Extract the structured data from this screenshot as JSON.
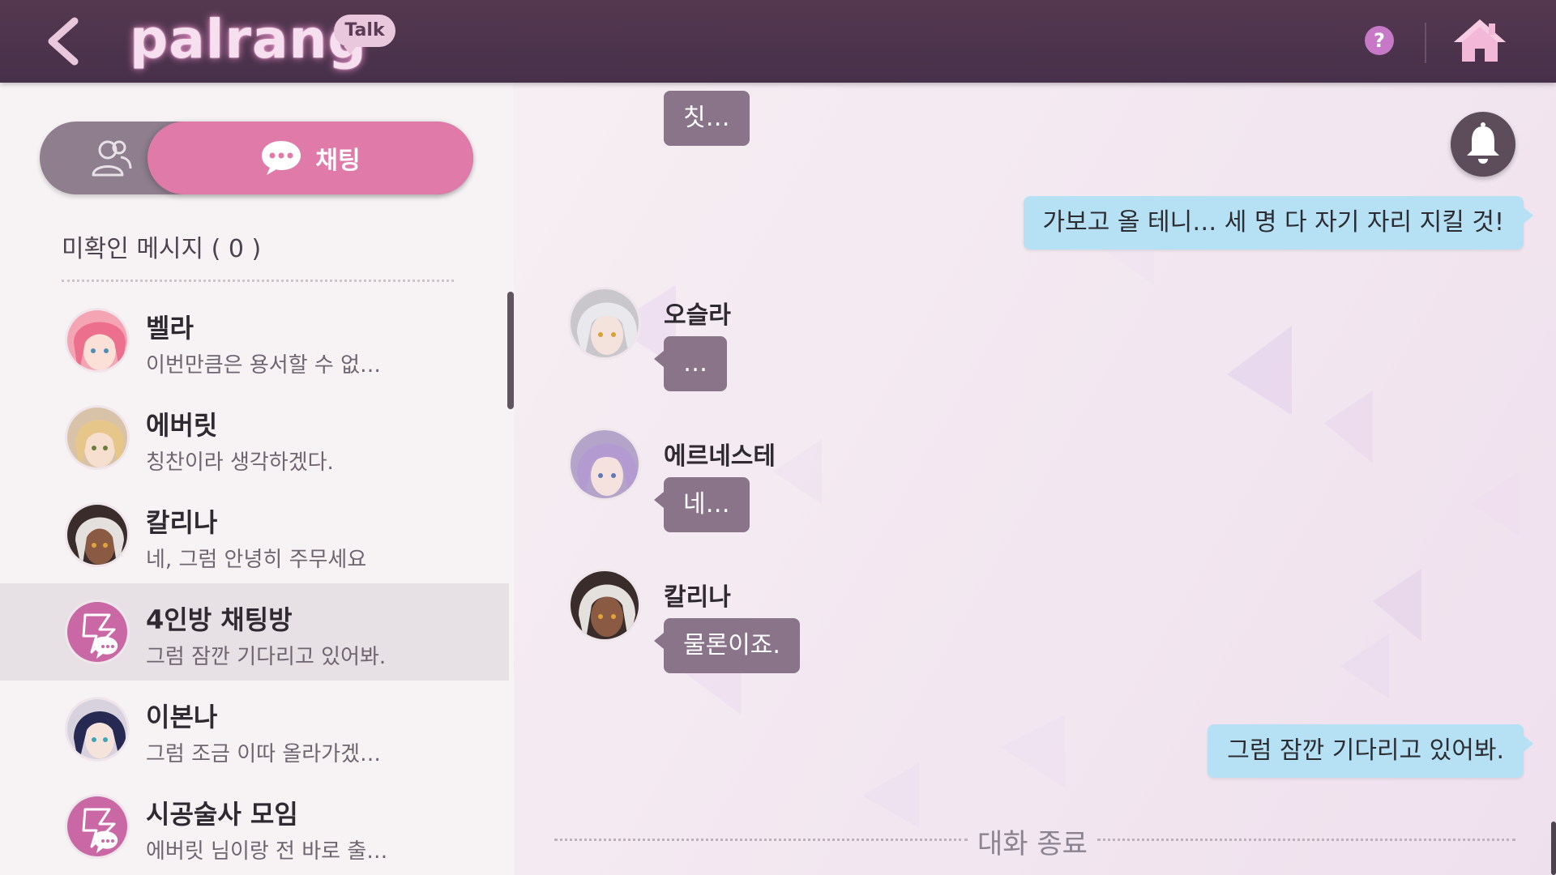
{
  "header": {
    "logo": "palrang",
    "badge": "Talk",
    "help_symbol": "?",
    "icons": [
      "back-arrow-icon",
      "help-icon",
      "home-icon"
    ]
  },
  "sidebar": {
    "tabs": [
      {
        "icon": "friends-icon",
        "label": ""
      },
      {
        "icon": "chat-bubble-icon",
        "label": "채팅"
      }
    ],
    "unread_title": "미확인 메시지 ( 0 )",
    "chats": [
      {
        "name": "벨라",
        "preview": "이번만큼은 용서할 수 없…",
        "avatar": "bella-avatar",
        "color": "#f08c9e"
      },
      {
        "name": "에버릿",
        "preview": "칭찬이라 생각하겠다.",
        "avatar": "everit-avatar",
        "color": "#e8c79c"
      },
      {
        "name": "칼리나",
        "preview": "네, 그럼 안녕히 주무세요",
        "avatar": "kalina-avatar",
        "color": "#6b4a3c"
      },
      {
        "name": "4인방 채팅방",
        "preview": "그럼 잠깐 기다리고 있어봐.",
        "avatar": "group-chat-icon",
        "color": "#c968a4",
        "selected": true
      },
      {
        "name": "이본나",
        "preview": "그럼 조금 이따 올라가겠…",
        "avatar": "ivonna-avatar",
        "color": "#2b2f55"
      },
      {
        "name": "시공술사 모임",
        "preview": "에버릿 님이랑 전 바로 출…",
        "avatar": "group-chat-icon",
        "color": "#c968a4"
      }
    ]
  },
  "conversation": {
    "messages": [
      {
        "type": "other",
        "sender": "",
        "text": "칫…"
      },
      {
        "type": "mine",
        "text": "가보고 올 테니… 세 명 다 자기 자리 지킬 것!"
      },
      {
        "type": "other",
        "sender": "오슬라",
        "text": "…"
      },
      {
        "type": "other",
        "sender": "에르네스테",
        "text": "네…"
      },
      {
        "type": "other",
        "sender": "칼리나",
        "text": "물론이죠."
      },
      {
        "type": "mine",
        "text": "그럼 잠깐 기다리고 있어봐."
      }
    ],
    "end_label": "대화 종료",
    "bell_icon": "bell-icon"
  },
  "colors": {
    "topbar": "#4b3249",
    "accent_pink": "#e07aa9",
    "toggle_gray": "#8e7e8e",
    "bubble_other": "#897489",
    "bubble_mine": "#b6e1f4",
    "selected_row": "#e7e1e6"
  }
}
